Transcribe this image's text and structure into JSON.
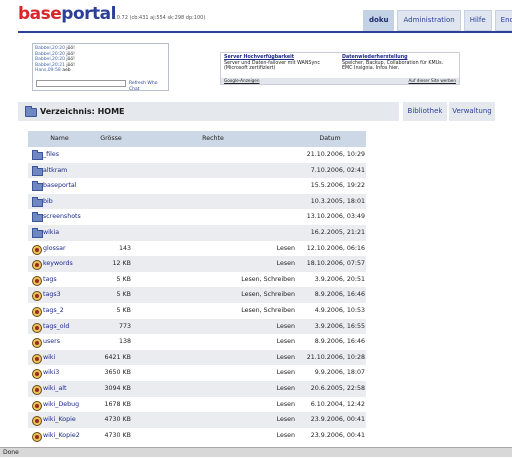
{
  "header": {
    "logo_part1": "base",
    "logo_part2": "portal",
    "version": "3.0.72 (cb:431 aj:554 sk:298 dp:100)",
    "nav": [
      {
        "label": "doku",
        "active": true
      },
      {
        "label": "Administration",
        "active": false
      },
      {
        "label": "Hilfe",
        "active": false
      },
      {
        "label": "Ende",
        "active": false
      }
    ]
  },
  "chat": {
    "lines": [
      {
        "time": "Babbel,20:20",
        "text": "jöö!"
      },
      {
        "time": "Babbel,20:20",
        "text": "jöö!"
      },
      {
        "time": "Babbel,20:20",
        "text": "jöö!"
      },
      {
        "time": "Babbel,20:21",
        "text": "jöö!"
      },
      {
        "time": "Hans,09:58",
        "text": "aeb"
      }
    ],
    "input_value": "",
    "refresh_label": "Refresh Who Chat"
  },
  "ads": {
    "ad1_title": "Server Hochverfügbarkeit",
    "ad1_text": "Server und Daten-failover mit WANSync (Microsoft zertifiziert)",
    "ad2_title": "Datenwiederherstellung",
    "ad2_text": "Speicher, Backup, Collaboration für KMUs. EMC Insignia. Infos hier.",
    "google_label": "Google-Anzeigen",
    "advertise_label": "Auf dieser Site werben"
  },
  "toolbar": {
    "title": "Verzeichnis: HOME",
    "library_label": "Bibliothek",
    "admin_label": "Verwaltung"
  },
  "table": {
    "headers": {
      "name": "Name",
      "size": "Grösse",
      "rights": "Rechte",
      "date": "Datum"
    },
    "rows": [
      {
        "type": "folder",
        "name": "_files",
        "size": "",
        "rights": "",
        "date": "21.10.2006, 10:29"
      },
      {
        "type": "folder",
        "name": "altkram",
        "size": "",
        "rights": "",
        "date": "7.10.2006, 02:41"
      },
      {
        "type": "folder",
        "name": "baseportal",
        "size": "",
        "rights": "",
        "date": "15.5.2006, 19:22"
      },
      {
        "type": "folder",
        "name": "bib",
        "size": "",
        "rights": "",
        "date": "10.3.2005, 18:01"
      },
      {
        "type": "folder",
        "name": "screenshots",
        "size": "",
        "rights": "",
        "date": "13.10.2006, 03:49"
      },
      {
        "type": "folder",
        "name": "wikia",
        "size": "",
        "rights": "",
        "date": "16.2.2005, 21:21"
      },
      {
        "type": "file",
        "name": "glossar",
        "size": "143",
        "rights": "Lesen",
        "date": "12.10.2006, 06:16"
      },
      {
        "type": "file",
        "name": "keywords",
        "size": "12 KB",
        "rights": "Lesen",
        "date": "18.10.2006, 07:57"
      },
      {
        "type": "file",
        "name": "tags",
        "size": "5 KB",
        "rights": "Lesen, Schreiben",
        "date": "3.9.2006, 20:51"
      },
      {
        "type": "file",
        "name": "tags3",
        "size": "5 KB",
        "rights": "Lesen, Schreiben",
        "date": "8.9.2006, 16:46"
      },
      {
        "type": "file",
        "name": "tags_2",
        "size": "5 KB",
        "rights": "Lesen, Schreiben",
        "date": "4.9.2006, 10:53"
      },
      {
        "type": "file",
        "name": "tags_old",
        "size": "773",
        "rights": "Lesen",
        "date": "3.9.2006, 16:55"
      },
      {
        "type": "file",
        "name": "users",
        "size": "138",
        "rights": "Lesen",
        "date": "8.9.2006, 16:46"
      },
      {
        "type": "file",
        "name": "wiki",
        "size": "6421 KB",
        "rights": "Lesen",
        "date": "21.10.2006, 10:28"
      },
      {
        "type": "file",
        "name": "wiki3",
        "size": "3650 KB",
        "rights": "Lesen",
        "date": "9.9.2006, 18:07"
      },
      {
        "type": "file",
        "name": "wiki_alt",
        "size": "3094 KB",
        "rights": "Lesen",
        "date": "20.6.2005, 22:58"
      },
      {
        "type": "file",
        "name": "wiki_Debug",
        "size": "1678 KB",
        "rights": "Lesen",
        "date": "6.10.2004, 12:42"
      },
      {
        "type": "file",
        "name": "wiki_Kopie",
        "size": "4730 KB",
        "rights": "Lesen",
        "date": "23.9.2006, 00:41"
      },
      {
        "type": "file",
        "name": "wiki_Kopie2",
        "size": "4730 KB",
        "rights": "Lesen",
        "date": "23.9.2006, 00:41"
      }
    ]
  },
  "status_bar": {
    "text": "Done"
  }
}
